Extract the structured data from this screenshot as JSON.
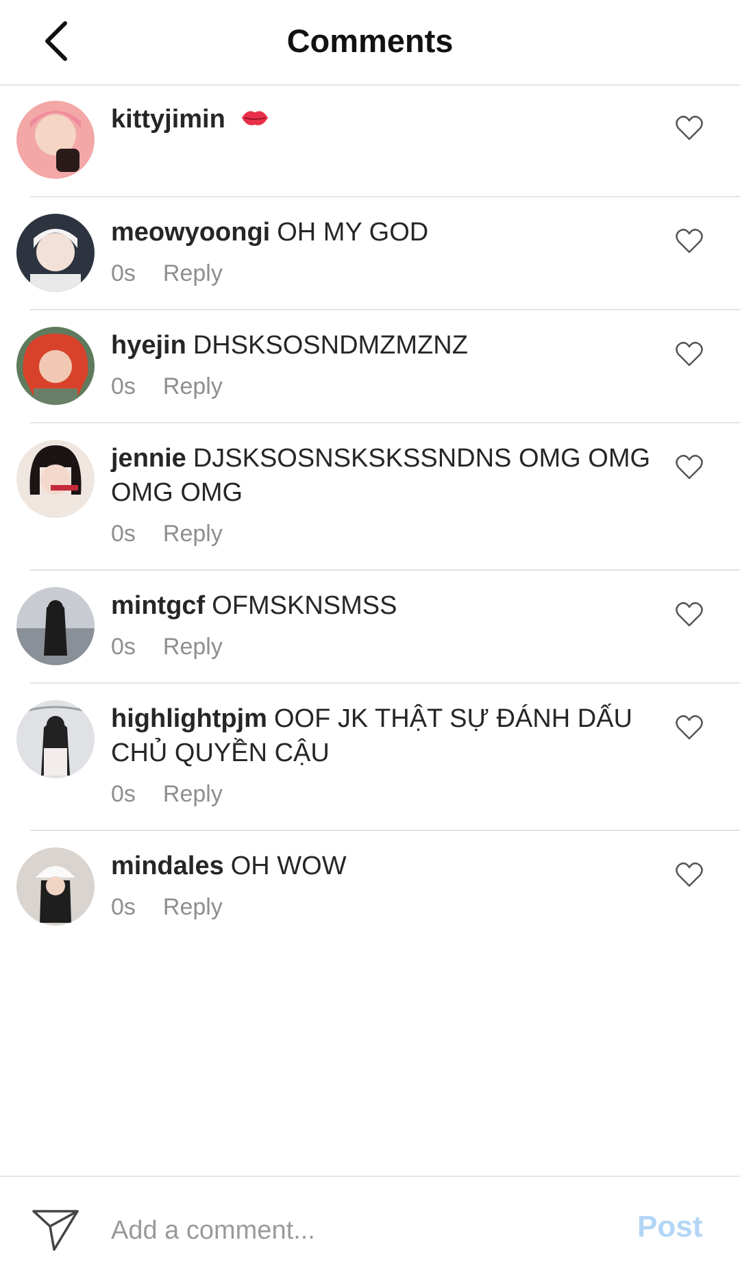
{
  "header": {
    "title": "Comments",
    "back_icon": "chevron-left-icon"
  },
  "comments": [
    {
      "username": "kittyjimin",
      "text": "",
      "emoji": "kiss-mark-icon",
      "time": "",
      "reply": ""
    },
    {
      "username": "meowyoongi",
      "text": "OH MY GOD",
      "time": "0s",
      "reply": "Reply"
    },
    {
      "username": "hyejin",
      "text": "DHSKSOSNDMZMZNZ",
      "time": "0s",
      "reply": "Reply"
    },
    {
      "username": "jennie",
      "text": "DJSKSOSNSKSKSSNDNS OMG OMG OMG OMG",
      "time": "0s",
      "reply": "Reply"
    },
    {
      "username": "mintgcf",
      "text": "OFMSKNSMSS",
      "time": "0s",
      "reply": "Reply"
    },
    {
      "username": "highlightpjm",
      "text": "OOF JK THẬT SỰ ĐÁNH DẤU CHỦ QUYỀN CẬU",
      "time": "0s",
      "reply": "Reply"
    },
    {
      "username": "mindales",
      "text": "OH WOW",
      "time": "0s",
      "reply": "Reply"
    }
  ],
  "footer": {
    "placeholder": "Add a comment...",
    "post_label": "Post",
    "send_icon": "send-icon"
  },
  "colors": {
    "post": "#b3d6f7",
    "meta": "#8e8e8e",
    "divider": "#e3e3e3"
  }
}
